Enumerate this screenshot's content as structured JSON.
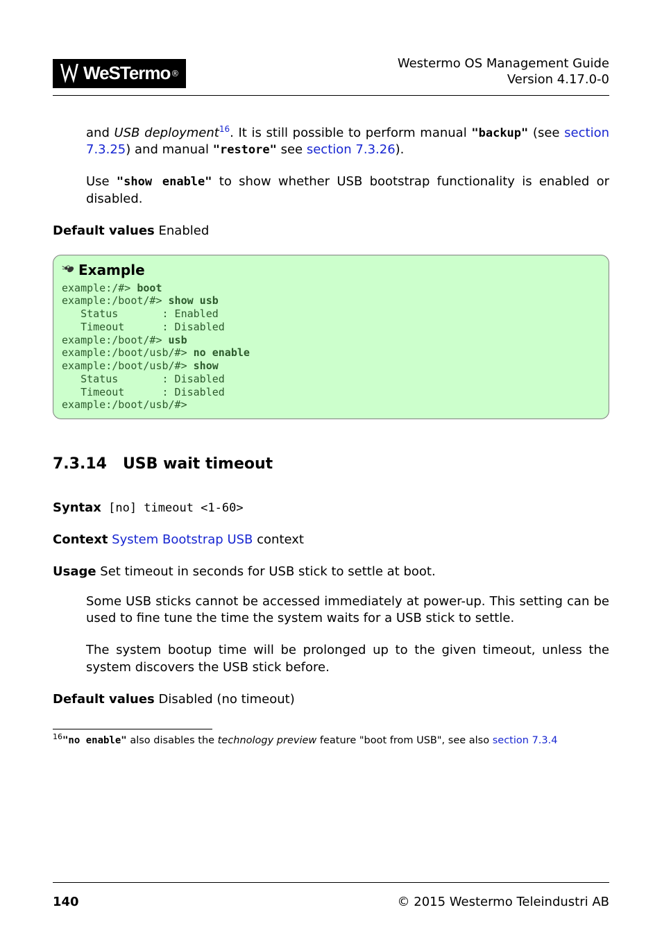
{
  "header": {
    "logo_text": "WeSTermo",
    "doc_title_line1": "Westermo OS Management Guide",
    "doc_title_line2": "Version 4.17.0-0"
  },
  "body": {
    "p1_a": "and ",
    "p1_i": "USB deployment",
    "p1_sup": "16",
    "p1_b": ". It is still possible to perform manual ",
    "p1_code1": "\"backup\"",
    "p1_c": " (see ",
    "p1_link1": "section 7.3.25",
    "p1_d": ") and manual ",
    "p1_code2": "\"restore\"",
    "p1_e": " see ",
    "p1_link2": "section 7.3.26",
    "p1_f": ").",
    "p2_a": "Use ",
    "p2_code": "\"show enable\"",
    "p2_b": " to show whether USB bootstrap functionality is enabled or disabled.",
    "dv_label": "Default values",
    "dv_value": " Enabled"
  },
  "example": {
    "title": "Example",
    "l1p": "example:/#> ",
    "l1c": "boot",
    "l2p": "example:/boot/#> ",
    "l2c": "show usb",
    "l3": "   Status       : Enabled",
    "l4": "   Timeout      : Disabled",
    "l5p": "example:/boot/#> ",
    "l5c": "usb",
    "l6p": "example:/boot/usb/#> ",
    "l6c": "no enable",
    "l7p": "example:/boot/usb/#> ",
    "l7c": "show",
    "l8": "   Status       : Disabled",
    "l9": "   Timeout      : Disabled",
    "l10": "example:/boot/usb/#>"
  },
  "section": {
    "number": "7.3.14",
    "title": "USB wait timeout",
    "syntax_label": "Syntax",
    "syntax_code": " [no] timeout <1-60>",
    "context_label": "Context",
    "context_link": "System Bootstrap USB",
    "context_suffix": " context",
    "usage_label": "Usage",
    "usage_text": " Set timeout in seconds for USB stick to settle at boot.",
    "usage_p1": "Some USB sticks cannot be accessed immediately at power-up. This setting can be used to fine tune the time the system waits for a USB stick to settle.",
    "usage_p2": "The system bootup time will be prolonged up to the given timeout, unless the system discovers the USB stick before.",
    "dv_label": "Default values",
    "dv_value": " Disabled (no timeout)"
  },
  "footnote": {
    "mark": "16",
    "code": "\"no enable\"",
    "a": " also disables the ",
    "i": "technology preview",
    "b": " feature \"boot from USB\", see also ",
    "link": "section 7.3.4"
  },
  "footer": {
    "page": "140",
    "copyright": "© 2015 Westermo Teleindustri AB"
  }
}
